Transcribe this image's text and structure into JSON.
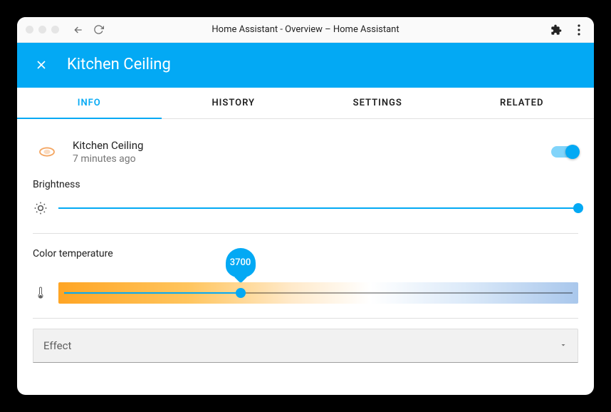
{
  "chrome": {
    "title": "Home Assistant - Overview – Home Assistant"
  },
  "header": {
    "title": "Kitchen Ceiling"
  },
  "tabs": [
    {
      "label": "Info",
      "active": true
    },
    {
      "label": "History",
      "active": false
    },
    {
      "label": "Settings",
      "active": false
    },
    {
      "label": "Related",
      "active": false
    }
  ],
  "entity": {
    "name": "Kitchen Ceiling",
    "last_changed": "7 minutes ago",
    "state_on": true
  },
  "brightness": {
    "label": "Brightness",
    "percent": 100
  },
  "color_temperature": {
    "label": "Color temperature",
    "value": 3700,
    "value_display": "3700",
    "min": 2000,
    "max": 6500,
    "percent": 35
  },
  "effect": {
    "label": "Effect"
  },
  "colors": {
    "accent": "#03a9f4"
  }
}
